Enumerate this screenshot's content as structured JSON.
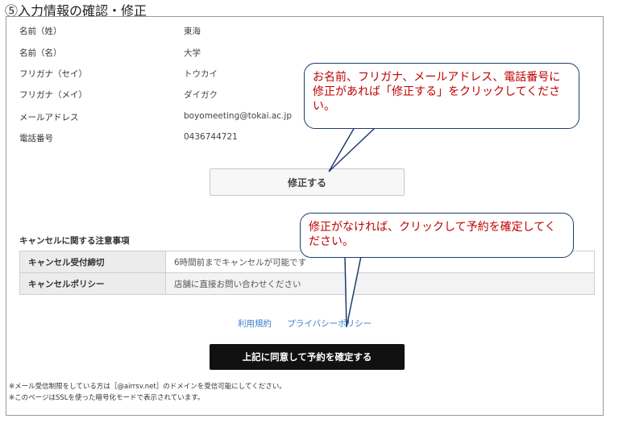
{
  "heading": "⑤入力情報の確認・修正",
  "info": [
    {
      "label": "名前（姓）",
      "value": "東海"
    },
    {
      "label": "名前（名）",
      "value": "大学"
    },
    {
      "label": "フリガナ（セイ）",
      "value": "トウカイ"
    },
    {
      "label": "フリガナ（メイ）",
      "value": "ダイガク"
    },
    {
      "label": "メールアドレス",
      "value": "boyomeeting@tokai.ac.jp"
    },
    {
      "label": "電話番号",
      "value": "0436744721"
    }
  ],
  "edit_button": "修正する",
  "cancel": {
    "title": "キャンセルに関する注意事項",
    "rows": [
      {
        "label": "キャンセル受付締切",
        "value": "6時間前までキャンセルが可能です"
      },
      {
        "label": "キャンセルポリシー",
        "value": "店舗に直接お問い合わせください"
      }
    ]
  },
  "links": {
    "terms": "利用規約",
    "privacy": "プライバシーポリシー"
  },
  "confirm_button": "上記に同意して予約を確定する",
  "notes": [
    "※メール受信制限をしている方は［@airrsv.net］のドメインを受信可能にしてください。",
    "※このページはSSLを使った暗号化モードで表示されています。"
  ],
  "callouts": {
    "edit": "お名前、フリガナ、メールアドレス、電話番号に修正があれば「修正する」をクリックしてください。",
    "confirm": "修正がなければ、クリックして予約を確定してください。"
  },
  "colors": {
    "callout_text": "#c00000",
    "callout_border": "#1f3b70",
    "link": "#3a7dc9",
    "confirm_bg": "#111111"
  }
}
